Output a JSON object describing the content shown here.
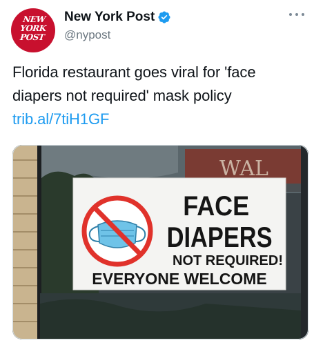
{
  "account": {
    "display_name": "New York Post",
    "handle": "@nypost",
    "avatar_lines": [
      "NEW",
      "YORK",
      "POST"
    ],
    "verified": true
  },
  "tweet": {
    "text": "Florida restaurant goes viral for 'face diapers not required' mask policy ",
    "link": "trib.al/7tiH1GF"
  },
  "media": {
    "sign_line1": "FACE",
    "sign_line2": "DIAPERS",
    "sign_line3": "NOT REQUIRED!",
    "sign_line4": "EVERYONE WELCOME",
    "storefront_text": "WAL"
  },
  "colors": {
    "accent": "#1d9bf0",
    "brand_red": "#c8102e",
    "prohibit_red": "#e0322b",
    "mask_blue": "#6fc3e8"
  },
  "icons": [
    "verified-badge-icon",
    "more-options-icon",
    "prohibited-icon",
    "face-mask-icon"
  ]
}
